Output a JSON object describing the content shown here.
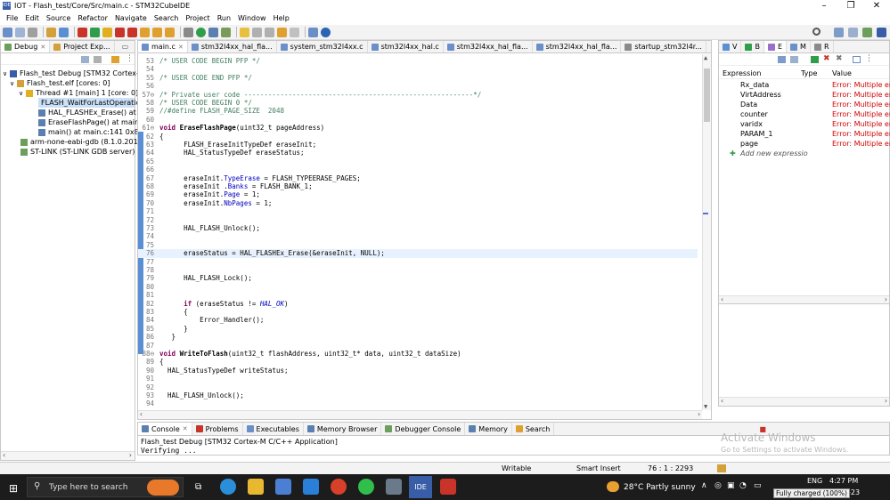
{
  "window": {
    "title": "IOT - Flash_test/Core/Src/main.c - STM32CubeIDE",
    "app_icon": "IDE"
  },
  "menu": [
    "File",
    "Edit",
    "Source",
    "Refactor",
    "Navigate",
    "Search",
    "Project",
    "Run",
    "Window",
    "Help"
  ],
  "debug_view": {
    "tabs": [
      {
        "label": "Debug"
      },
      {
        "label": "Project Exp..."
      }
    ],
    "tree": [
      {
        "label": "Flash_test Debug [STM32 Cortex-M C..."
      },
      {
        "label": "Flash_test.elf [cores: 0]"
      },
      {
        "label": "Thread #1 [main] 1 [core: 0] (Su..."
      },
      {
        "label": "FLASH_WaitForLastOperatio..."
      },
      {
        "label": "HAL_FLASHEx_Erase() at stm..."
      },
      {
        "label": "EraseFlashPage() at main.c:7..."
      },
      {
        "label": "main() at main.c:141 0x8000..."
      },
      {
        "label": "arm-none-eabi-gdb (8.1.0.2018031..."
      },
      {
        "label": "ST-LINK (ST-LINK GDB server)"
      }
    ]
  },
  "editor": {
    "tabs": [
      {
        "label": "main.c"
      },
      {
        "label": "stm32l4xx_hal_fla..."
      },
      {
        "label": "system_stm32l4xx.c"
      },
      {
        "label": "stm32l4xx_hal.c"
      },
      {
        "label": "stm32l4xx_hal_fla..."
      },
      {
        "label": "stm32l4xx_hal_fla..."
      },
      {
        "label": "startup_stm32l4r..."
      }
    ],
    "lines": [
      {
        "n": "53",
        "html": "<span class=\"cm\">/* USER CODE BEGIN PFP */</span>"
      },
      {
        "n": "54",
        "html": ""
      },
      {
        "n": "55",
        "html": "<span class=\"cm\">/* USER CODE END PFP */</span>"
      },
      {
        "n": "56",
        "html": ""
      },
      {
        "n": "57⊖",
        "html": "<span class=\"cm\">/* Private user code ---------------------------------------------------------*/</span>"
      },
      {
        "n": "58",
        "html": "<span class=\"cm\">/* USER CODE BEGIN 0 */</span>"
      },
      {
        "n": "59",
        "html": "<span class=\"cm\">//#define FLASH_PAGE_SIZE  2048</span>"
      },
      {
        "n": "60",
        "html": ""
      },
      {
        "n": "61⊖",
        "html": "<span class=\"kw\">void</span> <span class=\"fn\">EraseFlashPage</span>(uint32_t pageAddress)"
      },
      {
        "n": "62",
        "html": "{"
      },
      {
        "n": "63",
        "html": "      FLASH_EraseInitTypeDef eraseInit;"
      },
      {
        "n": "64",
        "html": "      HAL_StatusTypeDef eraseStatus;"
      },
      {
        "n": "65",
        "html": ""
      },
      {
        "n": "66",
        "html": ""
      },
      {
        "n": "67",
        "html": "      eraseInit.<span class=\"fld\">TypeErase</span> = FLASH_TYPEERASE_PAGES;"
      },
      {
        "n": "68",
        "html": "      eraseInit .<span class=\"fld\">Banks</span> = FLASH_BANK_1;"
      },
      {
        "n": "69",
        "html": "      eraseInit.<span class=\"fld\">Page</span> = 1;"
      },
      {
        "n": "70",
        "html": "      eraseInit.<span class=\"fld\">NbPages</span> = 1;"
      },
      {
        "n": "71",
        "html": ""
      },
      {
        "n": "72",
        "html": ""
      },
      {
        "n": "73",
        "html": "      HAL_FLASH_Unlock();"
      },
      {
        "n": "74",
        "html": ""
      },
      {
        "n": "75",
        "html": ""
      },
      {
        "n": "76",
        "html": "      eraseStatus = HAL_FLASHEx_Erase(&amp;eraseInit, NULL);"
      },
      {
        "n": "77",
        "html": ""
      },
      {
        "n": "78",
        "html": ""
      },
      {
        "n": "79",
        "html": "      HAL_FLASH_Lock();"
      },
      {
        "n": "80",
        "html": ""
      },
      {
        "n": "81",
        "html": ""
      },
      {
        "n": "82",
        "html": "      <span class=\"kw\">if</span> (eraseStatus != <span class=\"it\">HAL_OK</span>)"
      },
      {
        "n": "83",
        "html": "      {"
      },
      {
        "n": "84",
        "html": "          Error_Handler();"
      },
      {
        "n": "85",
        "html": "      }"
      },
      {
        "n": "86",
        "html": "   }"
      },
      {
        "n": "87",
        "html": ""
      },
      {
        "n": "88⊖",
        "html": "<span class=\"kw\">void</span> <span class=\"fn\">WriteToFlash</span>(uint32_t flashAddress, uint32_t* data, uint32_t dataSize)"
      },
      {
        "n": "89",
        "html": "{"
      },
      {
        "n": "90",
        "html": "  HAL_StatusTypeDef writeStatus;"
      },
      {
        "n": "91",
        "html": ""
      },
      {
        "n": "92",
        "html": ""
      },
      {
        "n": "93",
        "html": "  HAL_FLASH_Unlock();"
      },
      {
        "n": "94",
        "html": ""
      }
    ]
  },
  "expressions": {
    "tabs": [
      "V",
      "B",
      "E",
      "M",
      "R"
    ],
    "columns": [
      "Expression",
      "Type",
      "Value"
    ],
    "rows": [
      {
        "expr": "Rx_data",
        "value": "Error: Multiple erro"
      },
      {
        "expr": "VirtAddress",
        "value": "Error: Multiple erro"
      },
      {
        "expr": "Data",
        "value": "Error: Multiple erro"
      },
      {
        "expr": "counter",
        "value": "Error: Multiple erro"
      },
      {
        "expr": "varidx",
        "value": "Error: Multiple erro"
      },
      {
        "expr": "PARAM_1",
        "value": "Error: Multiple erro"
      },
      {
        "expr": "page",
        "value": "Error: Multiple erro"
      }
    ],
    "add_new": "Add new expressio"
  },
  "console": {
    "tabs": [
      "Console",
      "Problems",
      "Executables",
      "Memory Browser",
      "Debugger Console",
      "Memory",
      "Search"
    ],
    "launch": "Flash_test Debug [STM32 Cortex-M C/C++ Application]",
    "output": "Verifying ..."
  },
  "watermark": {
    "line1": "Activate Windows",
    "line2": "Go to Settings to activate Windows."
  },
  "status": {
    "mode": "Writable",
    "insert": "Smart Insert",
    "position": "76 : 1 : 2293"
  },
  "taskbar": {
    "search": "Type here to search",
    "weather": "28°C  Partly sunny",
    "lang": "ENG",
    "time": "4:27 PM",
    "date": "ep-23",
    "tooltip": "Fully charged (100%)"
  }
}
